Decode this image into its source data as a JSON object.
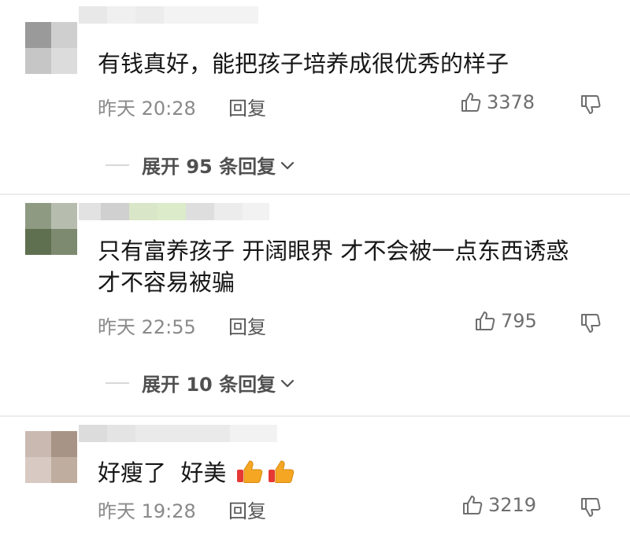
{
  "comments": [
    {
      "text": "有钱真好，能把孩子培养成很优秀的样子",
      "time": "昨天 20:28",
      "reply_label": "回复",
      "likes": "3378",
      "expand": "展开 95 条回复"
    },
    {
      "text_line1": "只有富养孩子 开阔眼界 才不会被一点东西诱惑",
      "text_line2": "才不容易被骗",
      "time": "昨天 22:55",
      "reply_label": "回复",
      "likes": "795",
      "expand": "展开 10 条回复"
    },
    {
      "text": "好瘦了  好美",
      "emoji": [
        "thumbs-up-emoji",
        "thumbs-up-emoji"
      ],
      "time": "昨天 19:28",
      "reply_label": "回复",
      "likes": "3219"
    }
  ],
  "icons": {
    "like": "thumbs-up-outline-icon",
    "dislike": "thumbs-down-outline-icon",
    "expand": "chevron-down-icon"
  },
  "colors": {
    "text": "#161616",
    "meta": "#8a8a8a",
    "expand_label": "#505050",
    "emoji": "#f5a623"
  }
}
